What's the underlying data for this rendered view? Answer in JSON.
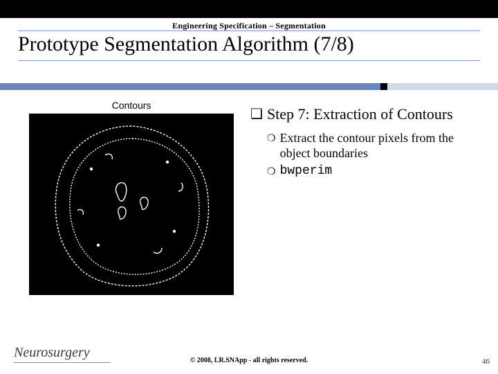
{
  "header": {
    "section_label": "Engineering Specification – Segmentation",
    "title": "Prototype Segmentation Algorithm (7/8)"
  },
  "figure": {
    "caption": "Contours"
  },
  "content": {
    "step_heading": "Step 7: Extraction of Contours",
    "sub_items": [
      {
        "text": "Extract the contour pixels from the object boundaries",
        "mono": false
      },
      {
        "text": "bwperim",
        "mono": true
      }
    ]
  },
  "footer": {
    "logo_text": "Neurosurgery",
    "copyright": "© 2008, LR.SNApp - all rights reserved.",
    "page_number": "46"
  },
  "bullet_glyphs": {
    "level1": "❑",
    "level2": "❍"
  }
}
